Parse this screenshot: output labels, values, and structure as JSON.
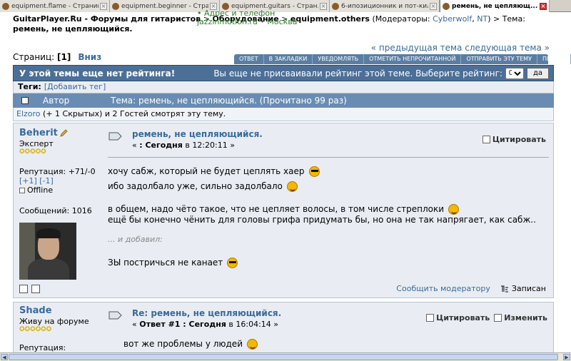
{
  "tabs": [
    {
      "label": "equipment.flame - Страниц...",
      "active": false
    },
    {
      "label": "equipment.beginner - Стра...",
      "active": false
    },
    {
      "label": "equipment.guitars - Стран...",
      "active": false
    },
    {
      "label": "6-ипозиционник и пот-кил...",
      "active": false
    },
    {
      "label": "ремень, не цепляющ...",
      "active": true
    }
  ],
  "breadcrumb": {
    "site": "GuitarPlayer.Ru - Форумы для гитаристов",
    "sep1": " > ",
    "cat": "Оборудование",
    "sep2": " > ",
    "forum": "equipment.others",
    "mods_label": " (Модераторы: ",
    "mod1": "Cyberwolf",
    "comma": ", ",
    "mod2": "NT",
    "mods_end": ") > Тема: ",
    "topic": "ремень, не цепляющийся."
  },
  "overlay": {
    "line1": "• Адрес и телефон",
    "line2": "jazzinmotion.ru  •  Москва"
  },
  "pages": {
    "label": "Страниц: ",
    "current": "[1]",
    "down": "Вниз"
  },
  "topic_nav": "« предыдущая тема следующая тема »",
  "buttons": [
    "ОТВЕТ",
    "В ЗАКЛАДКИ",
    "УВЕДОМЛЯТЬ",
    "ОТМЕТИТЬ НЕПРОЧИТАННОЙ",
    "ОТПРАВИТЬ ЭТУ ТЕМУ",
    "ПЕЧАТЬ"
  ],
  "rating": {
    "left": "У этой темы еще нет рейтинга!",
    "right": "Вы еще не присваивали рейтинг этой теме. Выберите рейтинг:",
    "select_value": "0",
    "go": "да"
  },
  "tags": {
    "label": "Теги:",
    "add": "[Добавить тег]"
  },
  "header": {
    "author": "Автор",
    "topic": "Тема: ремень, не цепляющийся.  (Прочитано 99 раз)"
  },
  "viewers": {
    "user": "Elzoro",
    "rest": " (+ 1 Скрытых) и 2 Гостей смотрят эту тему."
  },
  "post1": {
    "author": "Beherit",
    "rank": "Эксперт",
    "stars": "✪✪✪✪✪",
    "reputation": "Репутация: +71/-0",
    "rep_links": "[+1] [-1]",
    "status": "Offline",
    "messages": "Сообщений: 1016",
    "title": "ремень, не цепляющийся.",
    "date_prefix": "« ",
    "date_bold": ": Сегодня",
    "date_rest": " в 12:20:11 »",
    "quote": "Цитировать",
    "lines": [
      "хочу сабж, который не будет цеплять хаер",
      "ибо задолбало уже, сильно задолбало",
      "в общем, надо чёто такое, что не цепляет волосы, в том числе стреплоки",
      "ещё бы конечно чёнить для головы грифа придумать бы, но она не так напрягает, как сабж..",
      "... и добавил:",
      "ЗЫ постричься не канает"
    ],
    "report": "Сообщить модератору",
    "logged": "Записан"
  },
  "post2": {
    "author": "Shade",
    "rank": "Живу на форуме",
    "stars": "✪✪✪✪✪✪",
    "reputation": "Репутация:",
    "title": "Re: ремень, не цепляющийся.",
    "date_prefix": "« ",
    "date_bold": "Ответ #1 : Сегодня",
    "date_rest": " в 16:04:14 »",
    "quote": "Цитировать",
    "edit": "Изменить",
    "line1": "вот же проблемы у людей"
  }
}
